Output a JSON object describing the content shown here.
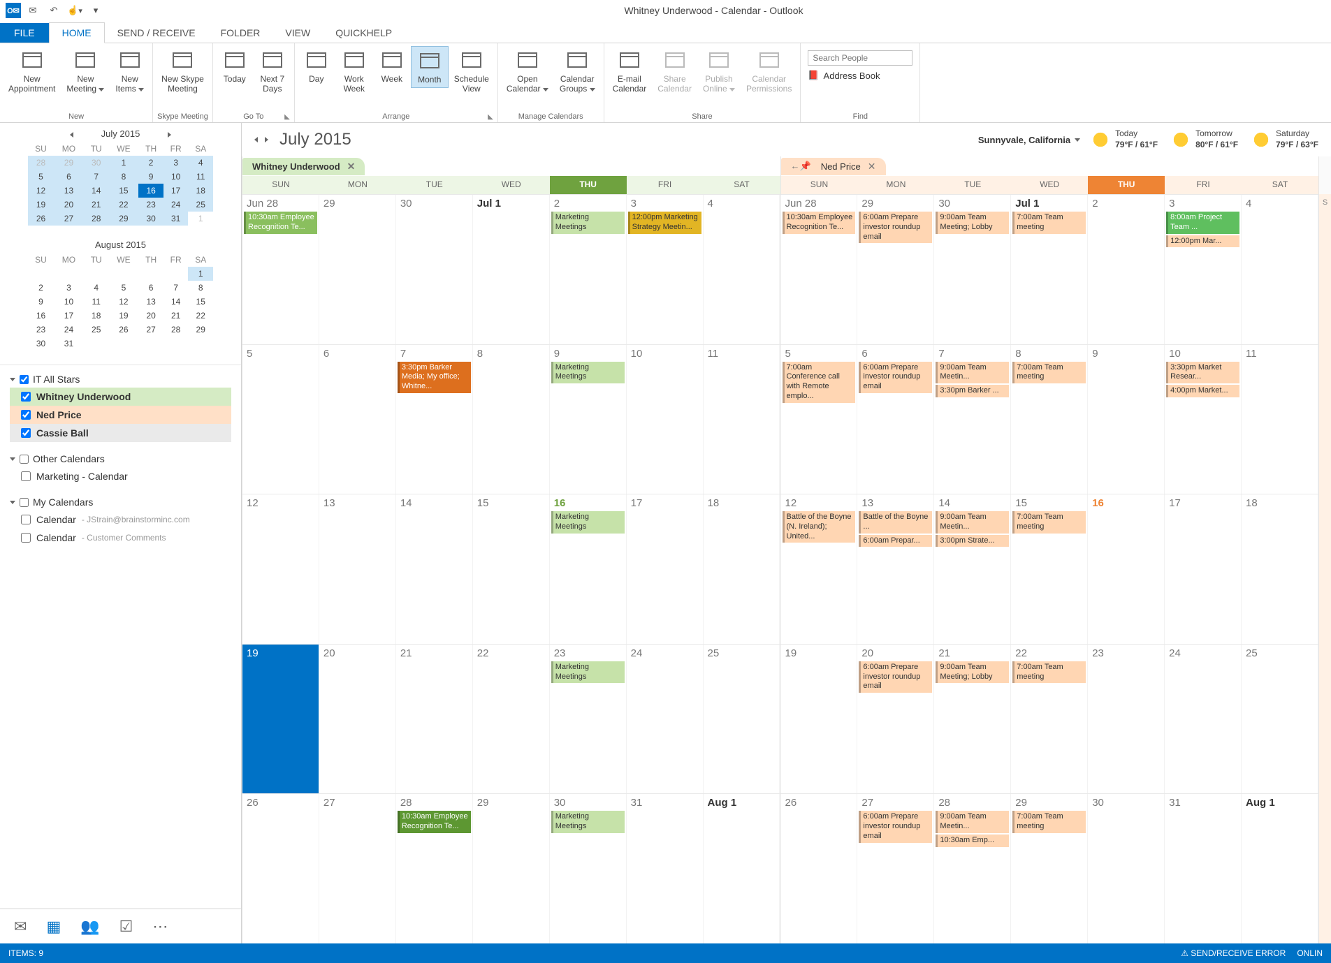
{
  "title": "Whitney Underwood - Calendar - Outlook",
  "tabs": {
    "file": "FILE",
    "list": [
      "HOME",
      "SEND / RECEIVE",
      "FOLDER",
      "VIEW",
      "QUICKHELP"
    ],
    "active": 0
  },
  "ribbon": {
    "groups": [
      {
        "label": "New",
        "dlg": false,
        "buttons": [
          {
            "label": "New\nAppointment"
          },
          {
            "label": "New\nMeeting",
            "dd": true
          },
          {
            "label": "New\nItems",
            "dd": true
          }
        ]
      },
      {
        "label": "Skype Meeting",
        "buttons": [
          {
            "label": "New Skype\nMeeting"
          }
        ]
      },
      {
        "label": "Go To",
        "dlg": true,
        "buttons": [
          {
            "label": "Today"
          },
          {
            "label": "Next 7\nDays"
          }
        ]
      },
      {
        "label": "Arrange",
        "dlg": true,
        "buttons": [
          {
            "label": "Day"
          },
          {
            "label": "Work\nWeek"
          },
          {
            "label": "Week"
          },
          {
            "label": "Month",
            "active": true
          },
          {
            "label": "Schedule\nView"
          }
        ]
      },
      {
        "label": "Manage Calendars",
        "buttons": [
          {
            "label": "Open\nCalendar",
            "dd": true
          },
          {
            "label": "Calendar\nGroups",
            "dd": true
          }
        ]
      },
      {
        "label": "Share",
        "buttons": [
          {
            "label": "E-mail\nCalendar"
          },
          {
            "label": "Share\nCalendar",
            "disabled": true
          },
          {
            "label": "Publish\nOnline",
            "dd": true,
            "disabled": true
          },
          {
            "label": "Calendar\nPermissions",
            "disabled": true
          }
        ]
      }
    ],
    "find": {
      "label": "Find",
      "placeholder": "Search People",
      "addressBook": "Address Book"
    }
  },
  "miniCals": [
    {
      "title": "July 2015",
      "nav": true,
      "dow": [
        "SU",
        "MO",
        "TU",
        "WE",
        "TH",
        "FR",
        "SA"
      ],
      "rows": [
        [
          {
            "d": 28,
            "dim": 1,
            "hl": 1
          },
          {
            "d": 29,
            "dim": 1,
            "hl": 1
          },
          {
            "d": 30,
            "dim": 1,
            "hl": 1
          },
          {
            "d": 1,
            "hl": 1
          },
          {
            "d": 2,
            "hl": 1
          },
          {
            "d": 3,
            "hl": 1
          },
          {
            "d": 4,
            "hl": 1
          }
        ],
        [
          {
            "d": 5,
            "hl": 1
          },
          {
            "d": 6,
            "hl": 1
          },
          {
            "d": 7,
            "hl": 1
          },
          {
            "d": 8,
            "hl": 1
          },
          {
            "d": 9,
            "hl": 1
          },
          {
            "d": 10,
            "hl": 1
          },
          {
            "d": 11,
            "hl": 1
          }
        ],
        [
          {
            "d": 12,
            "hl": 1
          },
          {
            "d": 13,
            "hl": 1
          },
          {
            "d": 14,
            "hl": 1
          },
          {
            "d": 15,
            "hl": 1
          },
          {
            "d": 16,
            "sel": 1
          },
          {
            "d": 17,
            "hl": 1
          },
          {
            "d": 18,
            "hl": 1
          }
        ],
        [
          {
            "d": 19,
            "hl": 1
          },
          {
            "d": 20,
            "hl": 1
          },
          {
            "d": 21,
            "hl": 1
          },
          {
            "d": 22,
            "hl": 1
          },
          {
            "d": 23,
            "hl": 1
          },
          {
            "d": 24,
            "hl": 1
          },
          {
            "d": 25,
            "hl": 1
          }
        ],
        [
          {
            "d": 26,
            "hl": 1
          },
          {
            "d": 27,
            "hl": 1
          },
          {
            "d": 28,
            "hl": 1
          },
          {
            "d": 29,
            "hl": 1
          },
          {
            "d": 30,
            "hl": 1
          },
          {
            "d": 31,
            "hl": 1
          },
          {
            "d": 1,
            "dim": 1
          }
        ]
      ]
    },
    {
      "title": "August 2015",
      "nav": false,
      "dow": [
        "SU",
        "MO",
        "TU",
        "WE",
        "TH",
        "FR",
        "SA"
      ],
      "rows": [
        [
          {
            "d": ""
          },
          {
            "d": ""
          },
          {
            "d": ""
          },
          {
            "d": ""
          },
          {
            "d": ""
          },
          {
            "d": ""
          },
          {
            "d": 1,
            "hl": 1
          }
        ],
        [
          {
            "d": 2
          },
          {
            "d": 3
          },
          {
            "d": 4
          },
          {
            "d": 5
          },
          {
            "d": 6
          },
          {
            "d": 7
          },
          {
            "d": 8
          }
        ],
        [
          {
            "d": 9
          },
          {
            "d": 10
          },
          {
            "d": 11
          },
          {
            "d": 12
          },
          {
            "d": 13
          },
          {
            "d": 14
          },
          {
            "d": 15
          }
        ],
        [
          {
            "d": 16
          },
          {
            "d": 17
          },
          {
            "d": 18
          },
          {
            "d": 19
          },
          {
            "d": 20
          },
          {
            "d": 21
          },
          {
            "d": 22
          }
        ],
        [
          {
            "d": 23
          },
          {
            "d": 24
          },
          {
            "d": 25
          },
          {
            "d": 26
          },
          {
            "d": 27
          },
          {
            "d": 28
          },
          {
            "d": 29
          }
        ],
        [
          {
            "d": 30
          },
          {
            "d": 31
          },
          {
            "d": ""
          },
          {
            "d": ""
          },
          {
            "d": ""
          },
          {
            "d": ""
          },
          {
            "d": ""
          }
        ]
      ]
    }
  ],
  "calLists": [
    {
      "title": "IT All Stars",
      "open": true,
      "checked": true,
      "items": [
        {
          "label": "Whitney Underwood",
          "cls": "whitney",
          "checked": true,
          "bold": true
        },
        {
          "label": "Ned Price",
          "cls": "ned",
          "checked": true,
          "bold": true
        },
        {
          "label": "Cassie Ball",
          "cls": "cassie",
          "checked": true,
          "bold": true
        }
      ]
    },
    {
      "title": "Other Calendars",
      "open": true,
      "checked": false,
      "items": [
        {
          "label": "Marketing - Calendar",
          "checked": false
        }
      ]
    },
    {
      "title": "My Calendars",
      "open": true,
      "checked": false,
      "items": [
        {
          "label": "Calendar",
          "sub": "- JStrain@brainstorminc.com",
          "checked": false
        },
        {
          "label": "Calendar",
          "sub": "- Customer Comments",
          "checked": false
        }
      ]
    }
  ],
  "calHeader": {
    "title": "July 2015",
    "location": "Sunnyvale, California",
    "weather": [
      {
        "label": "Today",
        "temp": "79°F / 61°F"
      },
      {
        "label": "Tomorrow",
        "temp": "80°F / 61°F"
      },
      {
        "label": "Saturday",
        "temp": "79°F / 63°F"
      }
    ]
  },
  "dow": [
    "SUN",
    "MON",
    "TUE",
    "WED",
    "THU",
    "FRI",
    "SAT"
  ],
  "panes": [
    {
      "name": "Whitney Underwood",
      "cls": "whitney",
      "weeks": [
        [
          {
            "d": "Jun 28",
            "ev": [
              {
                "c": "g1",
                "t": "10:30am Employee Recognition Te..."
              }
            ]
          },
          {
            "d": "29"
          },
          {
            "d": "30"
          },
          {
            "d": "Jul 1",
            "bold": 1
          },
          {
            "d": "2",
            "ev": [
              {
                "c": "g2",
                "t": "Marketing Meetings"
              }
            ]
          },
          {
            "d": "3",
            "ev": [
              {
                "c": "y1",
                "t": "12:00pm Marketing Strategy Meetin..."
              }
            ]
          },
          {
            "d": "4"
          }
        ],
        [
          {
            "d": "5"
          },
          {
            "d": "6"
          },
          {
            "d": "7",
            "ev": [
              {
                "c": "o1",
                "t": "3:30pm Barker Media; My office; Whitne..."
              }
            ]
          },
          {
            "d": "8"
          },
          {
            "d": "9",
            "ev": [
              {
                "c": "g2",
                "t": "Marketing Meetings"
              }
            ]
          },
          {
            "d": "10"
          },
          {
            "d": "11"
          }
        ],
        [
          {
            "d": "12"
          },
          {
            "d": "13"
          },
          {
            "d": "14"
          },
          {
            "d": "15"
          },
          {
            "d": "16",
            "today": 1,
            "ev": [
              {
                "c": "g2",
                "t": "Marketing Meetings"
              }
            ]
          },
          {
            "d": "17"
          },
          {
            "d": "18"
          }
        ],
        [
          {
            "d": "19",
            "sel": 1
          },
          {
            "d": "20"
          },
          {
            "d": "21"
          },
          {
            "d": "22"
          },
          {
            "d": "23",
            "ev": [
              {
                "c": "g2",
                "t": "Marketing Meetings"
              }
            ]
          },
          {
            "d": "24"
          },
          {
            "d": "25"
          }
        ],
        [
          {
            "d": "26"
          },
          {
            "d": "27"
          },
          {
            "d": "28",
            "ev": [
              {
                "c": "g3",
                "t": "10:30am Employee Recognition Te..."
              }
            ]
          },
          {
            "d": "29"
          },
          {
            "d": "30",
            "ev": [
              {
                "c": "g2",
                "t": "Marketing Meetings"
              }
            ]
          },
          {
            "d": "31"
          },
          {
            "d": "Aug 1",
            "bold": 1
          }
        ]
      ]
    },
    {
      "name": "Ned Price",
      "cls": "ned",
      "pin": true,
      "weeks": [
        [
          {
            "d": "Jun 28",
            "ev": [
              {
                "c": "n1",
                "t": "10:30am Employee Recognition Te..."
              }
            ]
          },
          {
            "d": "29",
            "ev": [
              {
                "c": "n1",
                "t": "6:00am Prepare investor roundup email"
              }
            ]
          },
          {
            "d": "30",
            "ev": [
              {
                "c": "n1",
                "t": "9:00am Team Meeting; Lobby"
              }
            ]
          },
          {
            "d": "Jul 1",
            "bold": 1,
            "ev": [
              {
                "c": "n1",
                "t": "7:00am Team meeting"
              }
            ]
          },
          {
            "d": "2"
          },
          {
            "d": "3",
            "ev": [
              {
                "c": "n2",
                "t": "8:00am Project Team ..."
              },
              {
                "c": "n1",
                "t": "12:00pm Mar..."
              }
            ]
          },
          {
            "d": "4"
          }
        ],
        [
          {
            "d": "5",
            "ev": [
              {
                "c": "n1",
                "t": "7:00am Conference call with Remote emplo..."
              }
            ]
          },
          {
            "d": "6",
            "ev": [
              {
                "c": "n1",
                "t": "6:00am Prepare investor roundup email"
              }
            ]
          },
          {
            "d": "7",
            "ev": [
              {
                "c": "n1",
                "t": "9:00am Team Meetin..."
              },
              {
                "c": "n1",
                "t": "3:30pm Barker ..."
              }
            ]
          },
          {
            "d": "8",
            "ev": [
              {
                "c": "n1",
                "t": "7:00am Team meeting"
              }
            ]
          },
          {
            "d": "9"
          },
          {
            "d": "10",
            "ev": [
              {
                "c": "n1",
                "t": "3:30pm Market Resear..."
              },
              {
                "c": "n1",
                "t": "4:00pm Market..."
              }
            ]
          },
          {
            "d": "11"
          }
        ],
        [
          {
            "d": "12",
            "ev": [
              {
                "c": "n1",
                "t": "Battle of the Boyne (N. Ireland); United..."
              }
            ]
          },
          {
            "d": "13",
            "ev": [
              {
                "c": "n1",
                "t": "Battle of the Boyne ..."
              },
              {
                "c": "n1",
                "t": "6:00am Prepar..."
              }
            ]
          },
          {
            "d": "14",
            "ev": [
              {
                "c": "n1",
                "t": "9:00am Team Meetin..."
              },
              {
                "c": "n1",
                "t": "3:00pm Strate..."
              }
            ]
          },
          {
            "d": "15",
            "ev": [
              {
                "c": "n1",
                "t": "7:00am Team meeting"
              }
            ]
          },
          {
            "d": "16",
            "today": 1
          },
          {
            "d": "17"
          },
          {
            "d": "18"
          }
        ],
        [
          {
            "d": "19"
          },
          {
            "d": "20",
            "ev": [
              {
                "c": "n1",
                "t": "6:00am Prepare investor roundup email"
              }
            ]
          },
          {
            "d": "21",
            "ev": [
              {
                "c": "n1",
                "t": "9:00am Team Meeting; Lobby"
              }
            ]
          },
          {
            "d": "22",
            "ev": [
              {
                "c": "n1",
                "t": "7:00am Team meeting"
              }
            ]
          },
          {
            "d": "23"
          },
          {
            "d": "24"
          },
          {
            "d": "25"
          }
        ],
        [
          {
            "d": "26"
          },
          {
            "d": "27",
            "ev": [
              {
                "c": "n1",
                "t": "6:00am Prepare investor roundup email"
              }
            ]
          },
          {
            "d": "28",
            "ev": [
              {
                "c": "n1",
                "t": "9:00am Team Meetin..."
              },
              {
                "c": "n1",
                "t": "10:30am Emp..."
              }
            ]
          },
          {
            "d": "29",
            "ev": [
              {
                "c": "n1",
                "t": "7:00am Team meeting"
              }
            ]
          },
          {
            "d": "30"
          },
          {
            "d": "31"
          },
          {
            "d": "Aug 1",
            "bold": 1
          }
        ]
      ]
    }
  ],
  "sliverCol": "S",
  "status": {
    "items": "ITEMS: 9",
    "error": "SEND/RECEIVE ERROR",
    "online": "ONLIN"
  }
}
